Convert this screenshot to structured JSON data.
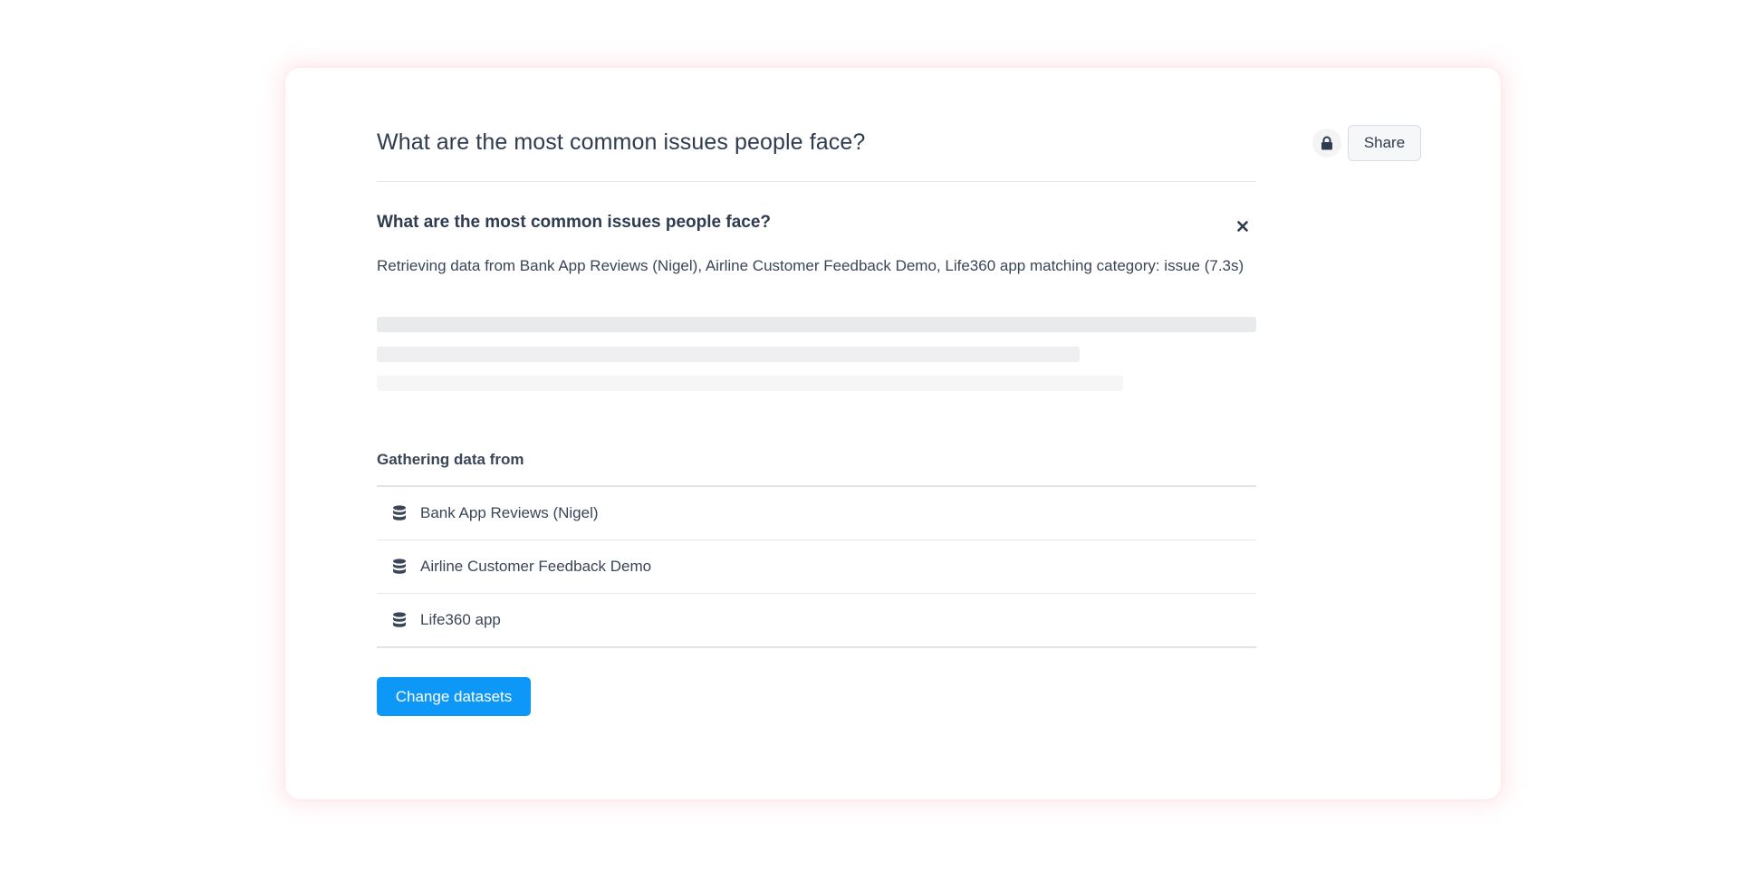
{
  "header": {
    "title": "What are the most common issues people face?",
    "share_label": "Share"
  },
  "query": {
    "title": "What are the most common issues people face?",
    "status": "Retrieving data from Bank App Reviews (Nigel), Airline Customer Feedback Demo, Life360 app matching category: issue (7.3s)"
  },
  "sources": {
    "heading": "Gathering data from",
    "items": [
      {
        "label": "Bank App Reviews (Nigel)",
        "icon": "database-icon"
      },
      {
        "label": "Airline Customer Feedback Demo",
        "icon": "database-icon"
      },
      {
        "label": "Life360 app",
        "icon": "database-icon"
      }
    ]
  },
  "actions": {
    "change_datasets_label": "Change datasets"
  },
  "colors": {
    "accent": "#0d98f7",
    "text": "#2f3b4f",
    "card_glow": "#ffc0cb"
  }
}
